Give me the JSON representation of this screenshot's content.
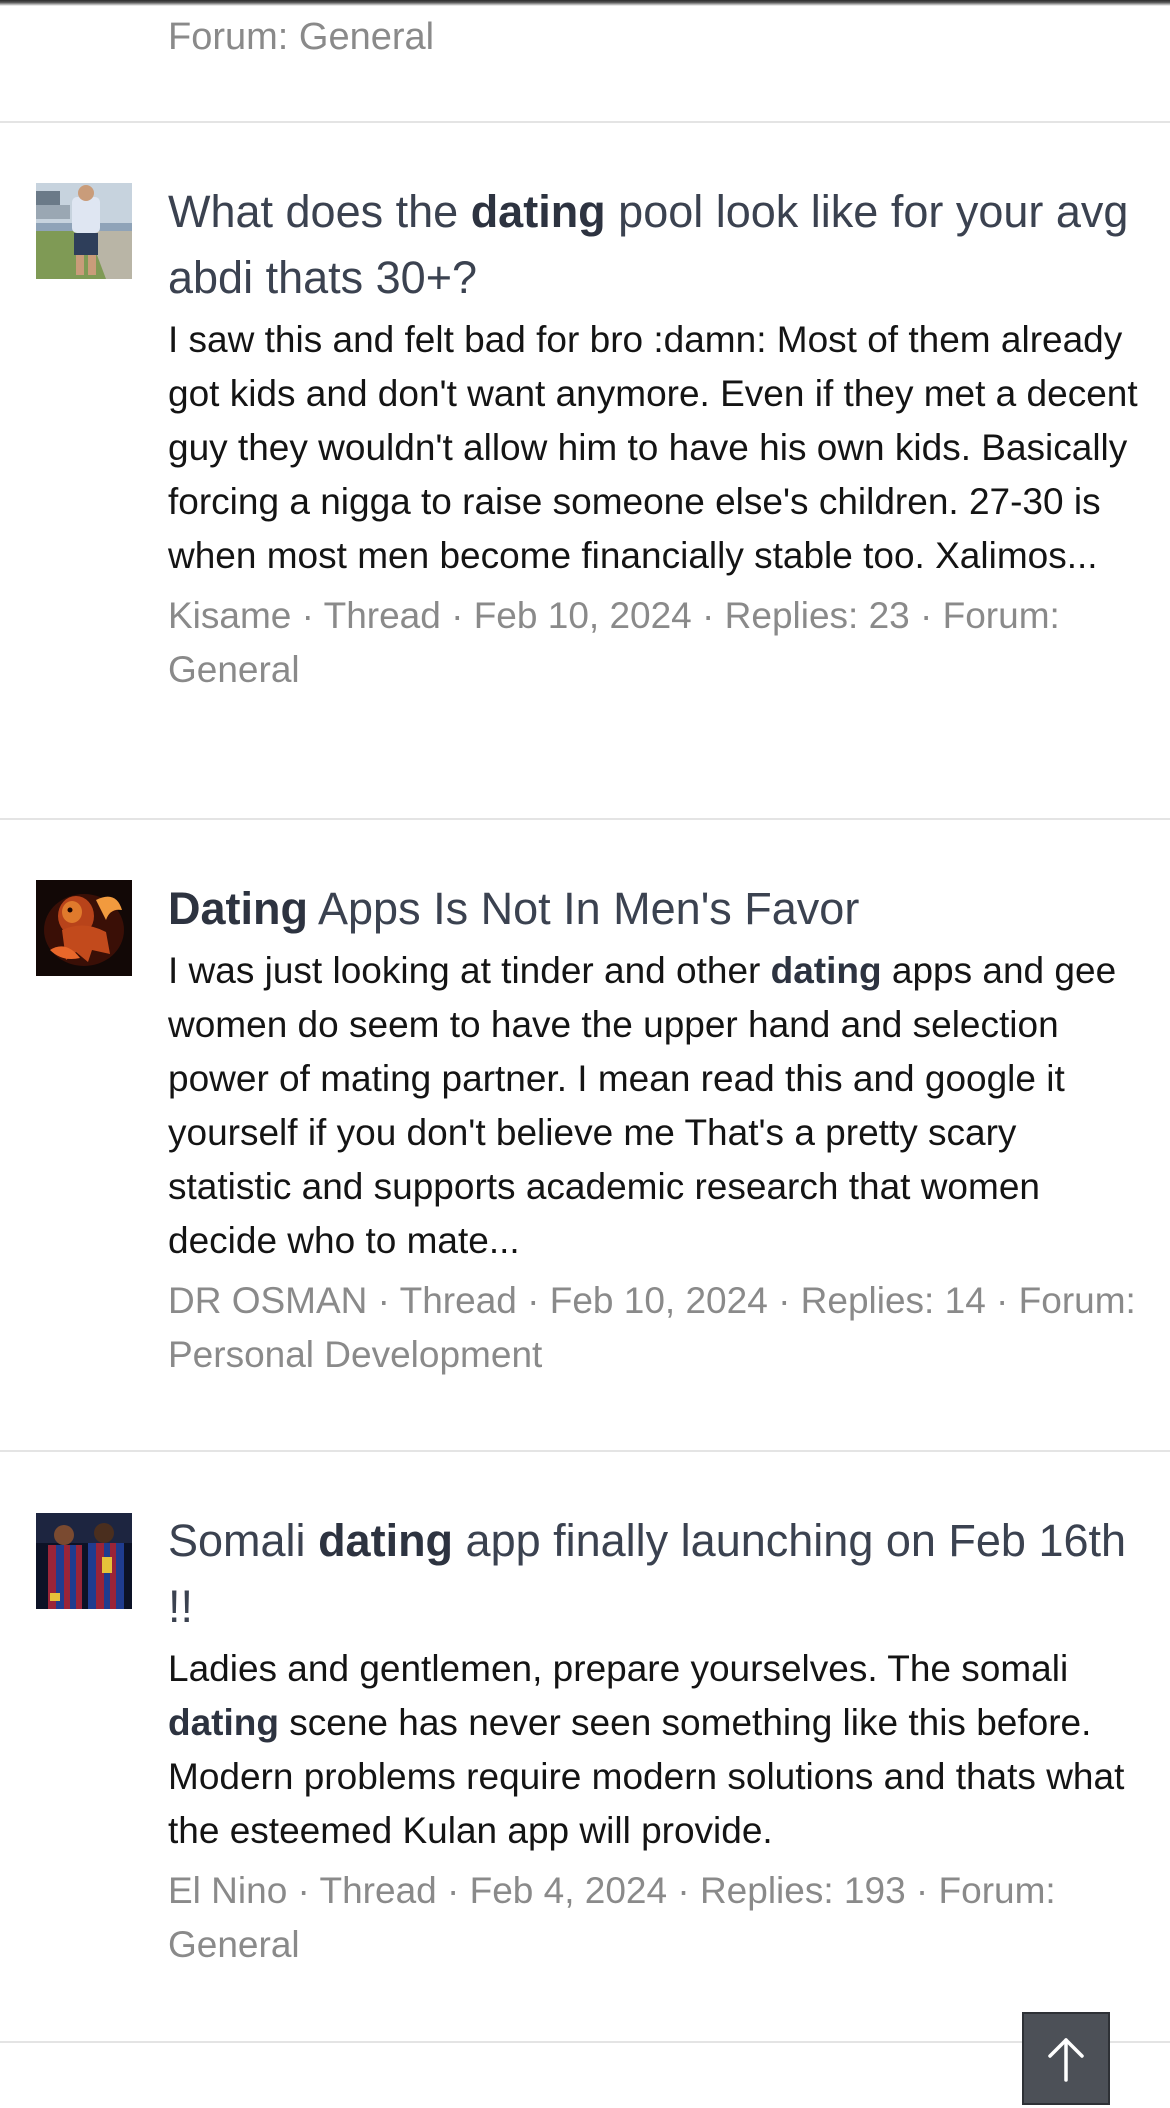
{
  "previous_result": {
    "meta_tail": "Forum: General"
  },
  "results": [
    {
      "title_pre": "What does the ",
      "title_kw": "dating",
      "title_post": " pool look like for your avg abdi thats 30+?",
      "snippet": "I saw this and felt bad for bro :damn: Most of them already got kids and don't want anymore. Even if they met a decent guy they wouldn't allow him to have his own kids. Basically forcing a nigga to raise someone else's children. 27-30 is when most men become financially stable too. Xalimos...",
      "meta": "Kisame · Thread · Feb 10, 2024 · Replies: 23 · Forum: General",
      "avatar": "user-photo-avatar"
    },
    {
      "title_kw": "Dating",
      "title_post": " Apps Is Not In Men's Favor",
      "snippet_pre": "I was just looking at tinder and other ",
      "snippet_kw": "dating",
      "snippet_post": " apps and gee women do seem to have the upper hand and selection power of mating partner. I mean read this and google it yourself if you don't believe me That's a pretty scary statistic and supports academic research that women decide who to mate...",
      "meta": "DR OSMAN · Thread · Feb 10, 2024 · Replies: 14 · Forum: Personal Development",
      "avatar": "fire-lion-avatar"
    },
    {
      "title_pre": "Somali ",
      "title_kw": "dating",
      "title_post": " app finally launching on Feb 16th !!",
      "snippet_pre": "Ladies and gentlemen, prepare yourselves. The somali ",
      "snippet_kw": "dating",
      "snippet_post": " scene has never seen something like this before. Modern problems require modern solutions and thats what the esteemed Kulan app will provide.",
      "meta": "El Nino · Thread · Feb 4, 2024 · Replies: 193 · Forum: General",
      "avatar": "footballers-avatar"
    }
  ],
  "back_to_top_icon": "arrow-up-icon",
  "colors": {
    "title": "#3b4250",
    "meta": "#8a8a8a",
    "divider": "#e4e4e4",
    "back_to_top_bg": "#4c5057"
  }
}
